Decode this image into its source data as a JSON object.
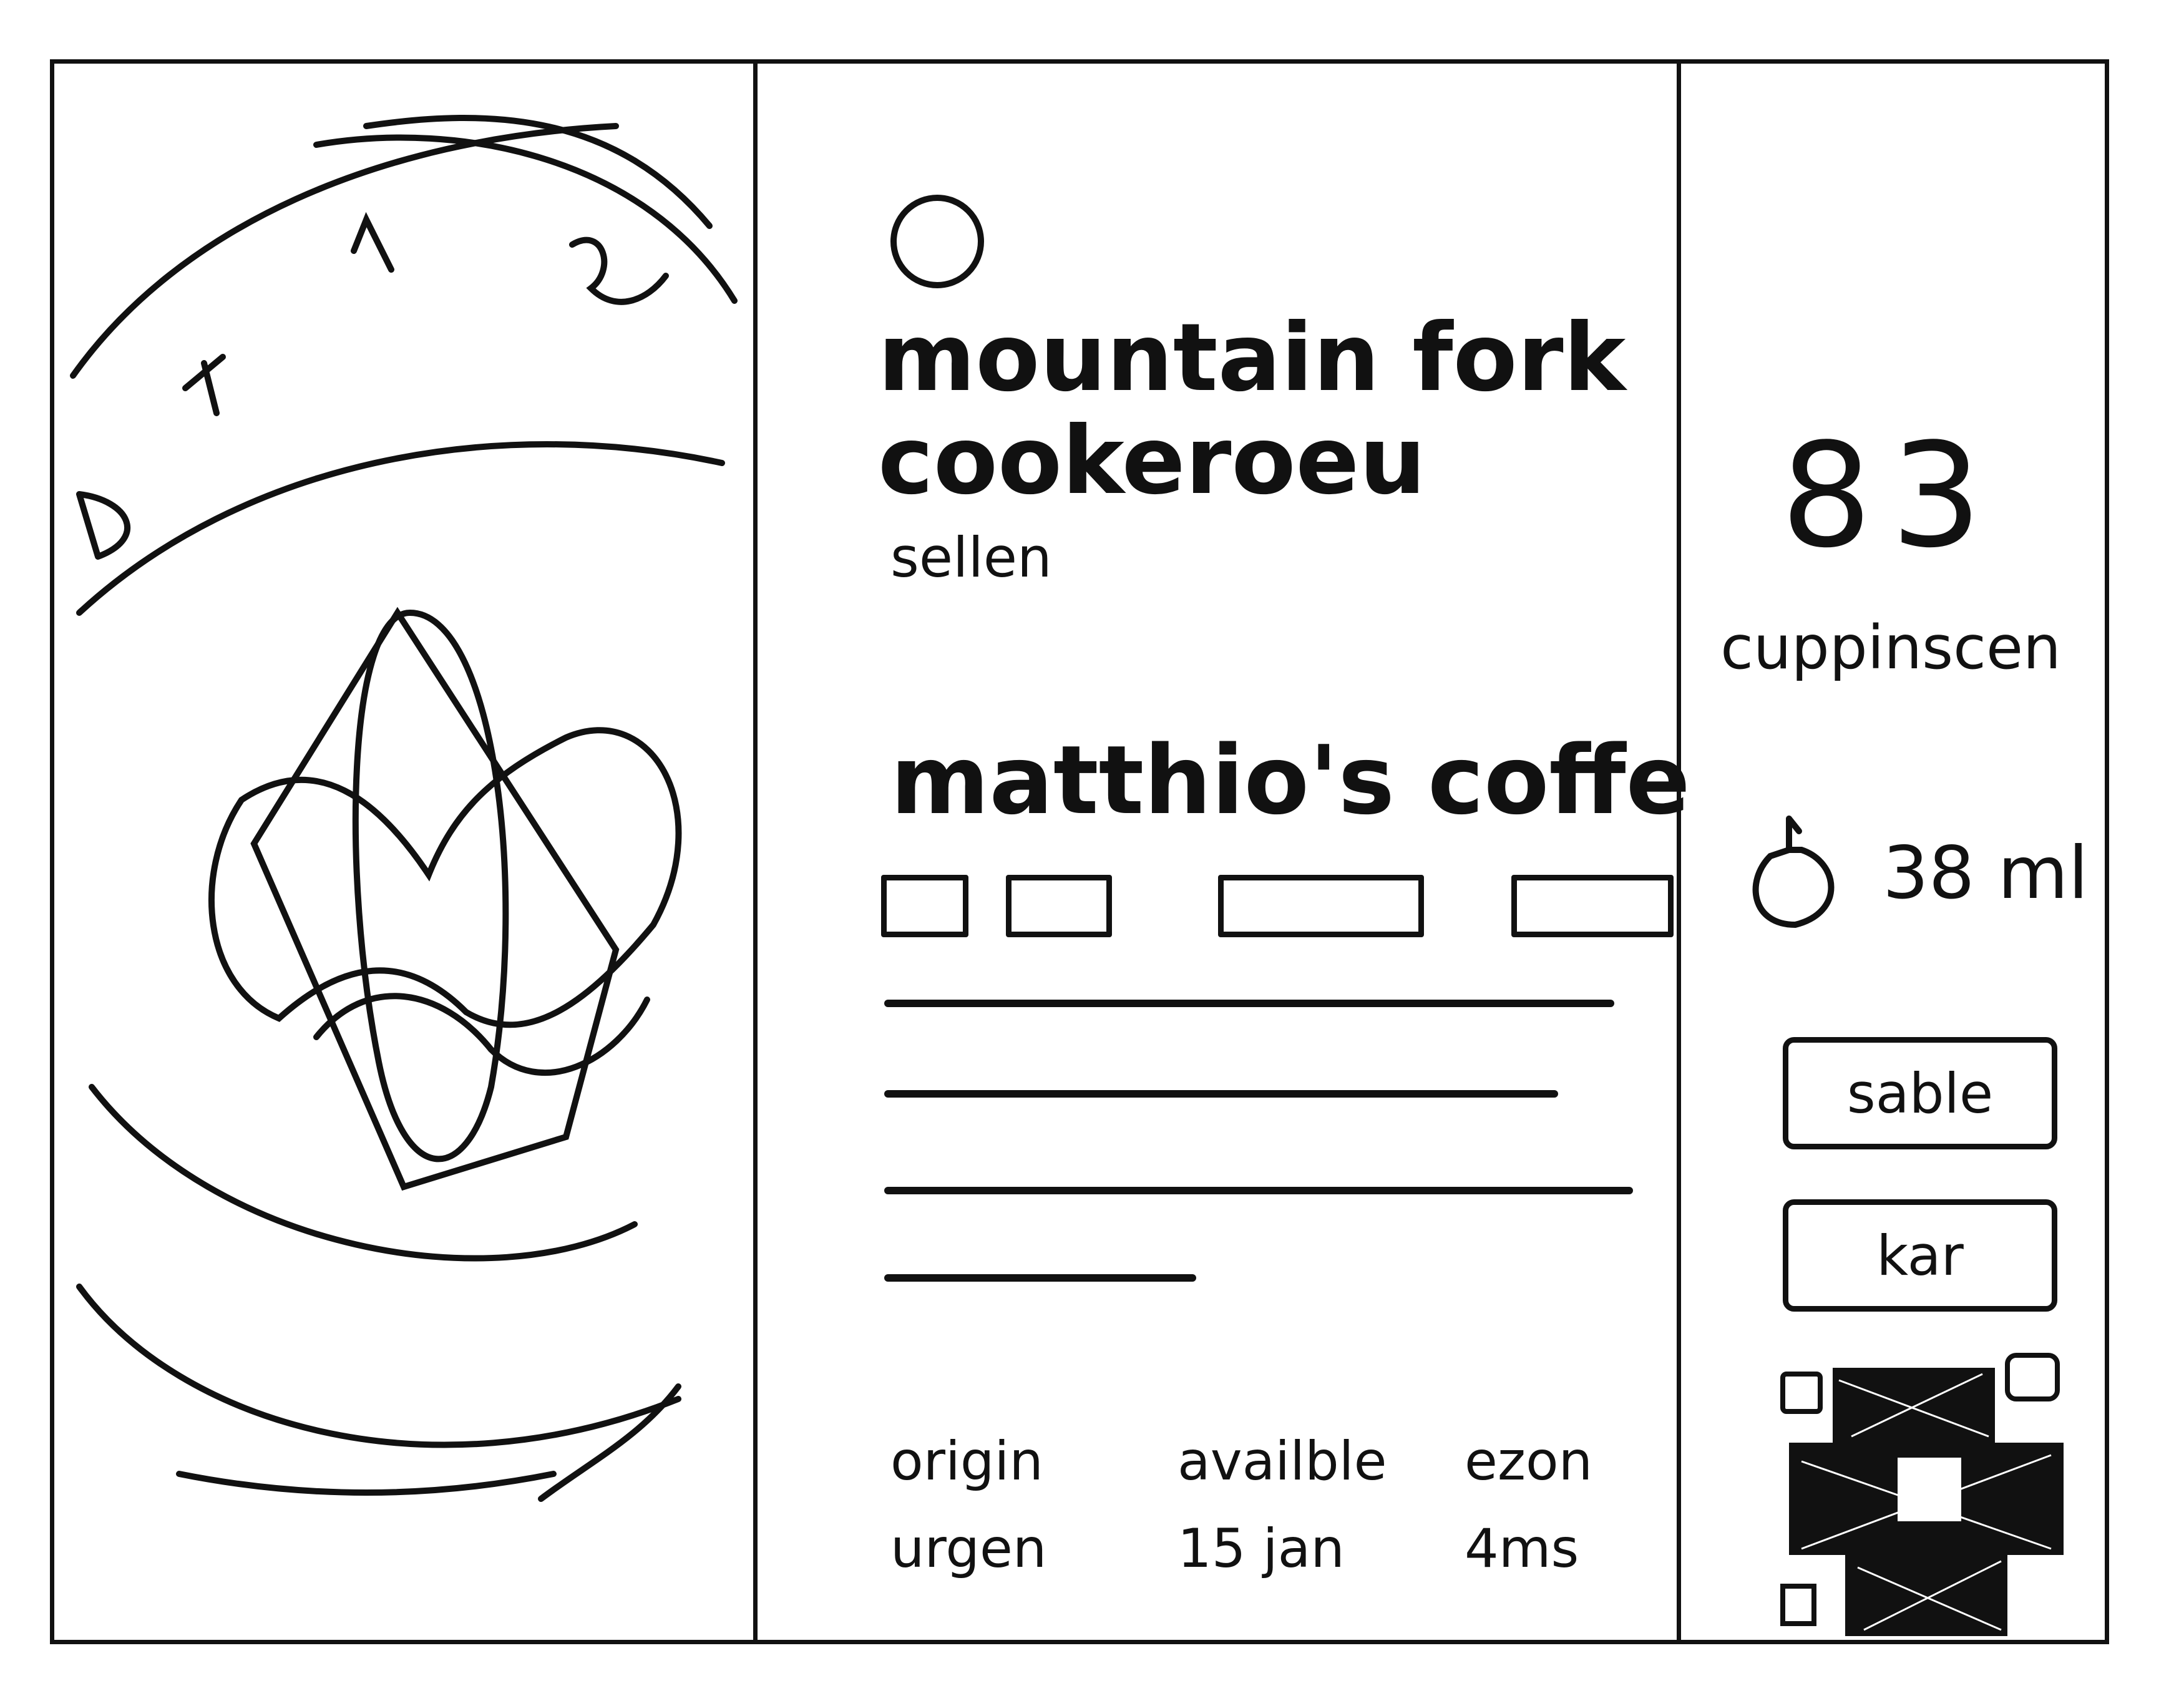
{
  "product": {
    "title": "mountain fork cookeroeu",
    "seller_label": "sellen",
    "seller_name": "matthio's coffe"
  },
  "info": {
    "labels": [
      "origin",
      "availble",
      "ezon"
    ],
    "values": [
      "urgen",
      "15 jan",
      "4ms"
    ]
  },
  "score": {
    "value": "83",
    "label": "cuppinscen"
  },
  "volume": {
    "text": "38 ml",
    "icon": "drop-bag-icon"
  },
  "actions": {
    "sample_label": "sable",
    "cart_label": "kar"
  },
  "colors": {
    "ink": "#111111",
    "paper": "#ffffff"
  }
}
